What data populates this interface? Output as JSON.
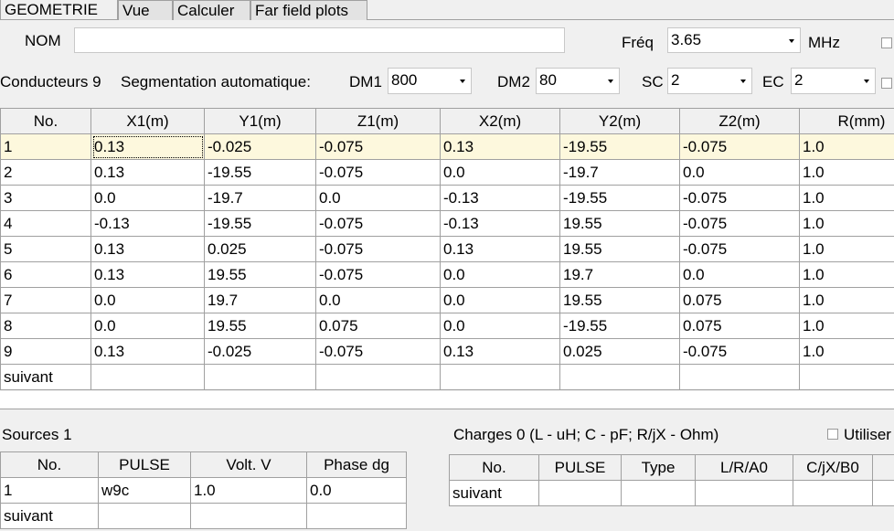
{
  "tabs": [
    {
      "label": "GEOMETRIE",
      "active": true
    },
    {
      "label": "Vue",
      "active": false
    },
    {
      "label": "Calculer",
      "active": false
    },
    {
      "label": "Far field plots",
      "active": false
    }
  ],
  "nom": {
    "label": "NOM",
    "value": ""
  },
  "freq": {
    "label": "Fréq",
    "value": "3.65",
    "unit": "MHz"
  },
  "params": {
    "conducteurs_label": "Conducteurs 9",
    "segmentation_label": "Segmentation automatique:",
    "dm1_label": "DM1",
    "dm1_value": "800",
    "dm2_label": "DM2",
    "dm2_value": "80",
    "sc_label": "SC",
    "sc_value": "2",
    "ec_label": "EC",
    "ec_value": "2"
  },
  "geometry": {
    "headers": [
      "No.",
      "X1(m)",
      "Y1(m)",
      "Z1(m)",
      "X2(m)",
      "Y2(m)",
      "Z2(m)",
      "R(mm)"
    ],
    "rows": [
      [
        "1",
        "0.13",
        "-0.025",
        "-0.075",
        "0.13",
        "-19.55",
        "-0.075",
        "1.0"
      ],
      [
        "2",
        "0.13",
        "-19.55",
        "-0.075",
        "0.0",
        "-19.7",
        "0.0",
        "1.0"
      ],
      [
        "3",
        "0.0",
        "-19.7",
        "0.0",
        "-0.13",
        "-19.55",
        "-0.075",
        "1.0"
      ],
      [
        "4",
        "-0.13",
        "-19.55",
        "-0.075",
        "-0.13",
        "19.55",
        "-0.075",
        "1.0"
      ],
      [
        "5",
        "0.13",
        "0.025",
        "-0.075",
        "0.13",
        "19.55",
        "-0.075",
        "1.0"
      ],
      [
        "6",
        "0.13",
        "19.55",
        "-0.075",
        "0.0",
        "19.7",
        "0.0",
        "1.0"
      ],
      [
        "7",
        "0.0",
        "19.7",
        "0.0",
        "0.0",
        "19.55",
        "0.075",
        "1.0"
      ],
      [
        "8",
        "0.0",
        "19.55",
        "0.075",
        "0.0",
        "-19.55",
        "0.075",
        "1.0"
      ],
      [
        "9",
        "0.13",
        "-0.025",
        "-0.075",
        "0.13",
        "0.025",
        "-0.075",
        "1.0"
      ]
    ],
    "next_label": "suivant"
  },
  "sources": {
    "title": "Sources 1",
    "headers": [
      "No.",
      "PULSE",
      "Volt. V",
      "Phase dg"
    ],
    "rows": [
      [
        "1",
        "w9c",
        "1.0",
        "0.0"
      ]
    ],
    "next_label": "suivant"
  },
  "charges": {
    "title": "Charges 0 (L - uH; C - pF; R/jX - Ohm)",
    "utiliser_label": "Utiliser",
    "headers": [
      "No.",
      "PULSE",
      "Type",
      "L/R/A0",
      "C/jX/B0",
      ""
    ],
    "next_label": "suivant"
  }
}
